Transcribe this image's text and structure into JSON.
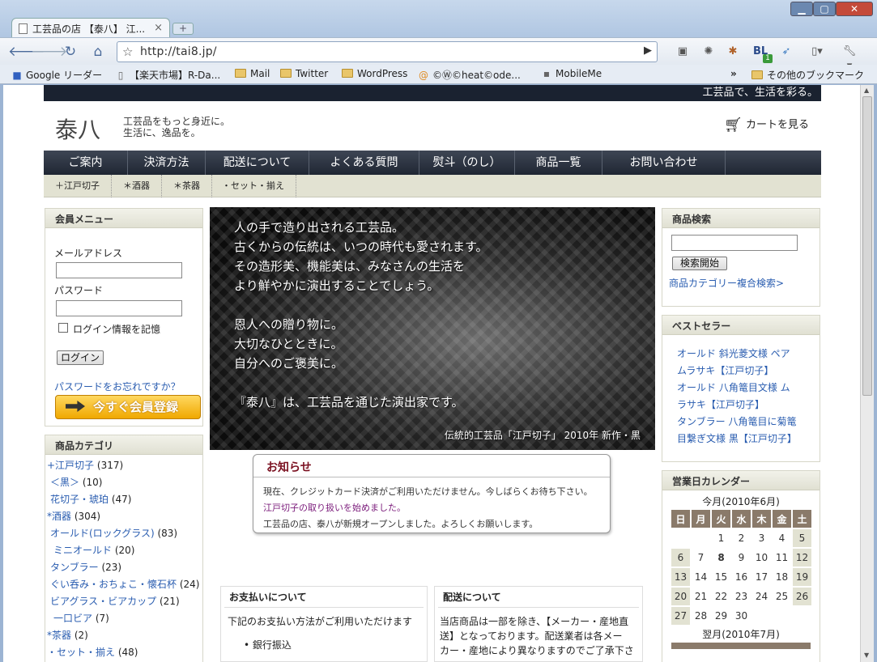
{
  "browser": {
    "tab_title": "工芸品の店 【泰八】 江...",
    "url": "http://tai8.jp/",
    "bookmarks": [
      "Google リーダー",
      "【楽天市場】R-Da...",
      "Mail",
      "Twitter",
      "WordPress",
      "©Ⓦ©heat©ode...",
      "MobileMe"
    ],
    "more_bookmarks": "その他のブックマーク",
    "ext_badge": "1"
  },
  "header": {
    "topbar": "工芸品で、生活を彩る。",
    "logo": "泰八",
    "tagline1": "工芸品をもっと身近に。",
    "tagline2": "生活に、逸品を。",
    "cart": "カートを見る"
  },
  "nav": [
    "ご案内",
    "決済方法",
    "配送について",
    "よくある質問",
    "熨斗（のし）",
    "商品一覧",
    "お問い合わせ"
  ],
  "subnav": [
    "＋江戸切子",
    "＊酒器",
    "＊茶器",
    "・セット・揃え"
  ],
  "login": {
    "title": "会員メニュー",
    "email_label": "メールアドレス",
    "password_label": "パスワード",
    "remember": "ログイン情報を記憶",
    "login_button": "ログイン",
    "forgot": "パスワードをお忘れですか？",
    "register": "今すぐ会員登録"
  },
  "categories": {
    "title": "商品カテゴリ",
    "items": [
      {
        "label": "+江戸切子",
        "count": "(317)"
      },
      {
        "label": "＜黒＞",
        "count": "(10)"
      },
      {
        "label": "花切子・琥珀",
        "count": "(47)"
      },
      {
        "label": "*酒器",
        "count": "(304)"
      },
      {
        "label": "オールド(ロックグラス)",
        "count": "(83)"
      },
      {
        "label": "ミニオールド",
        "count": "(20)"
      },
      {
        "label": "タンブラー",
        "count": "(23)"
      },
      {
        "label": "ぐい呑み・おちょこ・懐石杯",
        "count": "(24)"
      },
      {
        "label": "ビアグラス・ビアカップ",
        "count": "(21)"
      },
      {
        "label": "一口ビア",
        "count": "(7)"
      },
      {
        "label": "*茶器",
        "count": "(2)"
      },
      {
        "label": "・セット・揃え",
        "count": "(48)"
      }
    ]
  },
  "banner": {
    "lines": [
      "人の手で造り出される工芸品。",
      "古くからの伝統は、いつの時代も愛されます。",
      "その造形美、機能美は、みなさんの生活を",
      "より鮮やかに演出することでしょう。",
      "恩人への贈り物に。",
      "大切なひとときに。",
      "自分へのご褒美に。",
      "『泰八』は、工芸品を通じた演出家です。"
    ],
    "caption": "伝統的工芸品「江戸切子」 2010年 新作・黒"
  },
  "notice": {
    "title": "お知らせ",
    "lines": [
      "現在、クレジットカード決済がご利用いただけません。今しばらくお待ち下さい。",
      "江戸切子の取り扱いを始めました。",
      "工芸品の店、泰八が新規オープンしました。よろしくお願いします。"
    ]
  },
  "payment": {
    "title": "お支払いについて",
    "text": "下記のお支払い方法がご利用いただけます",
    "item": "銀行振込"
  },
  "shipping": {
    "title": "配送について",
    "lines": [
      "当店商品は一部を除き、【メーカー・産地直",
      "送】となっております。配送業者は各メー",
      "カー・産地により異なりますのでご了承下さ"
    ]
  },
  "search": {
    "title": "商品検索",
    "button": "検索開始",
    "advanced": "商品カテゴリー複合検索>"
  },
  "bestseller": {
    "title": "ベストセラー",
    "lines": [
      "オールド 斜光菱文様 ペア",
      "ムラサキ【江戸切子】",
      "オールド 八角篭目文様 ム",
      "ラサキ【江戸切子】",
      "タンブラー 八角篭目に菊篭",
      "目繋ぎ文様 黒【江戸切子】"
    ]
  },
  "calendar": {
    "title": "営業日カレンダー",
    "month": "今月(2010年6月)",
    "next_month": "翌月(2010年7月)",
    "weekdays": [
      "日",
      "月",
      "火",
      "水",
      "木",
      "金",
      "土"
    ],
    "weeks": [
      [
        "",
        "",
        "1",
        "2",
        "3",
        "4",
        "5"
      ],
      [
        "6",
        "7",
        "8",
        "9",
        "10",
        "11",
        "12"
      ],
      [
        "13",
        "14",
        "15",
        "16",
        "17",
        "18",
        "19"
      ],
      [
        "20",
        "21",
        "22",
        "23",
        "24",
        "25",
        "26"
      ],
      [
        "27",
        "28",
        "29",
        "30",
        "",
        "",
        ""
      ]
    ]
  }
}
